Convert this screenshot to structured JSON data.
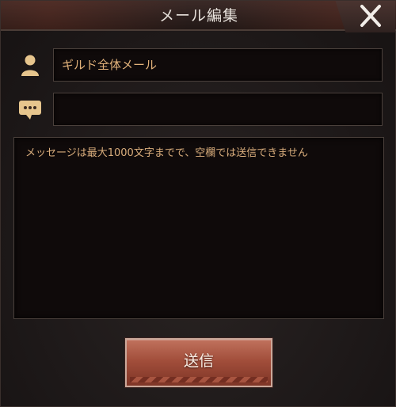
{
  "dialog": {
    "title": "メール編集",
    "close_icon": "close-icon"
  },
  "recipient": {
    "icon": "person-icon",
    "value": "ギルド全体メール"
  },
  "subject": {
    "icon": "chat-bubble-icon",
    "value": ""
  },
  "message": {
    "placeholder": "メッセージは最大1000文字までで、空欄では送信できません"
  },
  "send_button": {
    "label": "送信"
  },
  "colors": {
    "accent_text": "#e2b27a",
    "button_red": "#a24e3b"
  }
}
